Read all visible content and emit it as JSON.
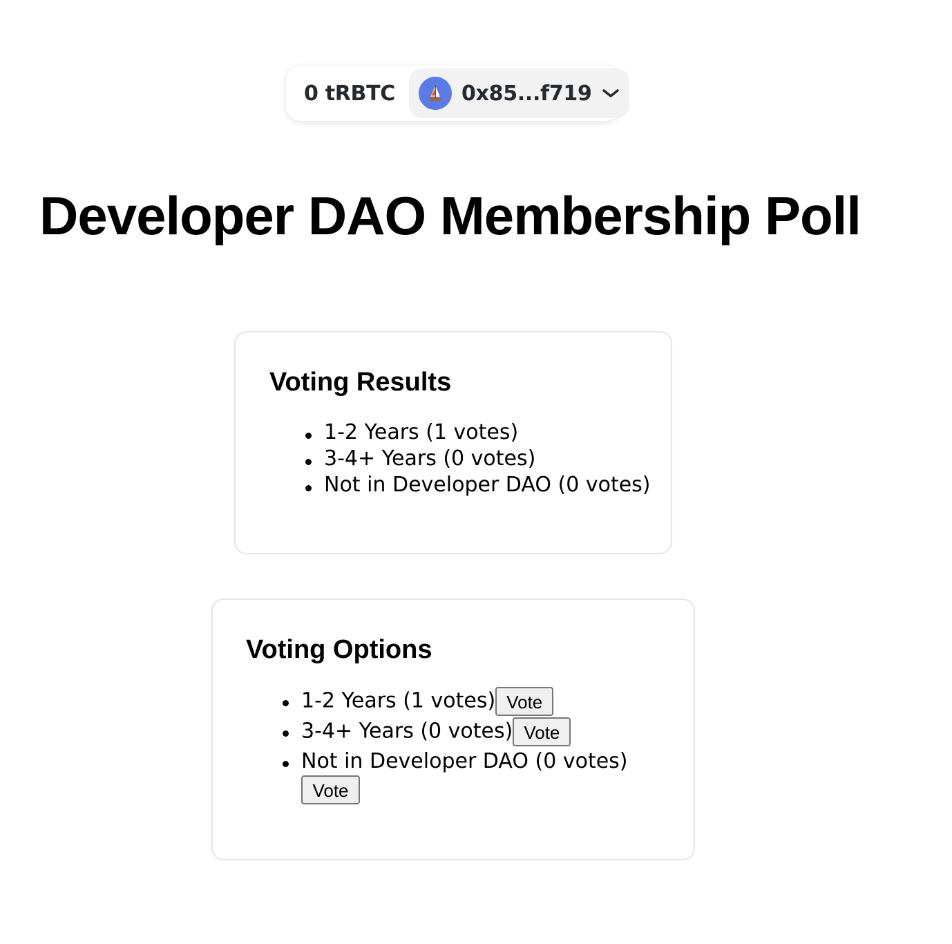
{
  "wallet": {
    "balance": "0 tRBTC",
    "address": "0x85...f719",
    "avatar_icon": "sailboat-emoji",
    "avatar_color": "#5a7ce8"
  },
  "page": {
    "title": "Developer DAO Membership Poll"
  },
  "results": {
    "heading": "Voting Results",
    "items": [
      {
        "label": "1-2 Years (1 votes)"
      },
      {
        "label": "3-4+ Years (0 votes)"
      },
      {
        "label": "Not in Developer DAO (0 votes)"
      }
    ]
  },
  "options": {
    "heading": "Voting Options",
    "items": [
      {
        "label": "1-2 Years (1 votes)",
        "button": "Vote"
      },
      {
        "label": "3-4+ Years (0 votes)",
        "button": "Vote"
      },
      {
        "label": "Not in Developer DAO (0 votes)",
        "button": "Vote"
      }
    ]
  }
}
